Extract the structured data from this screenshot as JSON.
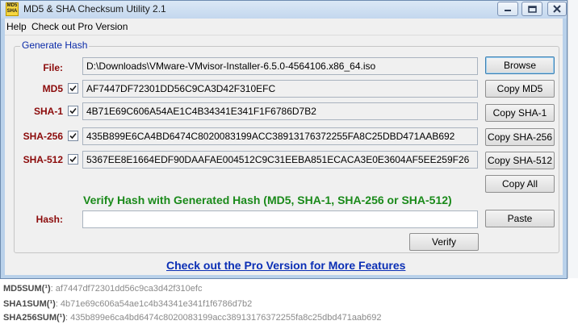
{
  "window": {
    "title": "MD5 & SHA Checksum Utility 2.1",
    "icon_text_top": "MD5",
    "icon_text_bottom": "SHA"
  },
  "menu": {
    "items": [
      {
        "label": "Help"
      },
      {
        "label": "Check out Pro Version"
      }
    ]
  },
  "generate": {
    "group_title": "Generate Hash",
    "file_label": "File:",
    "file_value": "D:\\Downloads\\VMware-VMvisor-Installer-6.5.0-4564106.x86_64.iso",
    "browse_label": "Browse",
    "rows": [
      {
        "label": "MD5",
        "checked": true,
        "value": "AF7447DF72301DD56C9CA3D42F310EFC",
        "button": "Copy MD5"
      },
      {
        "label": "SHA-1",
        "checked": true,
        "value": "4B71E69C606A54AE1C4B34341E341F1F6786D7B2",
        "button": "Copy SHA-1"
      },
      {
        "label": "SHA-256",
        "checked": true,
        "value": "435B899E6CA4BD6474C8020083199ACC38913176372255FA8C25DBD471AAB692",
        "button": "Copy SHA-256"
      },
      {
        "label": "SHA-512",
        "checked": true,
        "value": "5367EE8E1664EDF90DAAFAE004512C9C31EEBA851ECACA3E0E3604AF5EE259F26",
        "button": "Copy SHA-512"
      }
    ],
    "copy_all_label": "Copy All"
  },
  "verify": {
    "heading": "Verify Hash with Generated Hash (MD5, SHA-1, SHA-256 or SHA-512)",
    "hash_label": "Hash:",
    "hash_value": "",
    "paste_label": "Paste",
    "verify_label": "Verify"
  },
  "promo": {
    "link_text": "Check out the Pro Version for More Features"
  },
  "background": {
    "lines": [
      {
        "key": "MD5SUM(¹)",
        "value": "af7447df72301dd56c9ca3d42f310efc"
      },
      {
        "key": "SHA1SUM(¹)",
        "value": "4b71e69c606a54ae1c4b34341e341f1f6786d7b2"
      },
      {
        "key": "SHA256SUM(¹)",
        "value": "435b899e6ca4bd6474c8020083199acc38913176372255fa8c25dbd471aab692"
      }
    ]
  },
  "colors": {
    "label_red": "#8b0a0a",
    "group_title_blue": "#0a2aa8",
    "verify_green": "#1a8a1a",
    "link_blue": "#0b2fb5"
  }
}
